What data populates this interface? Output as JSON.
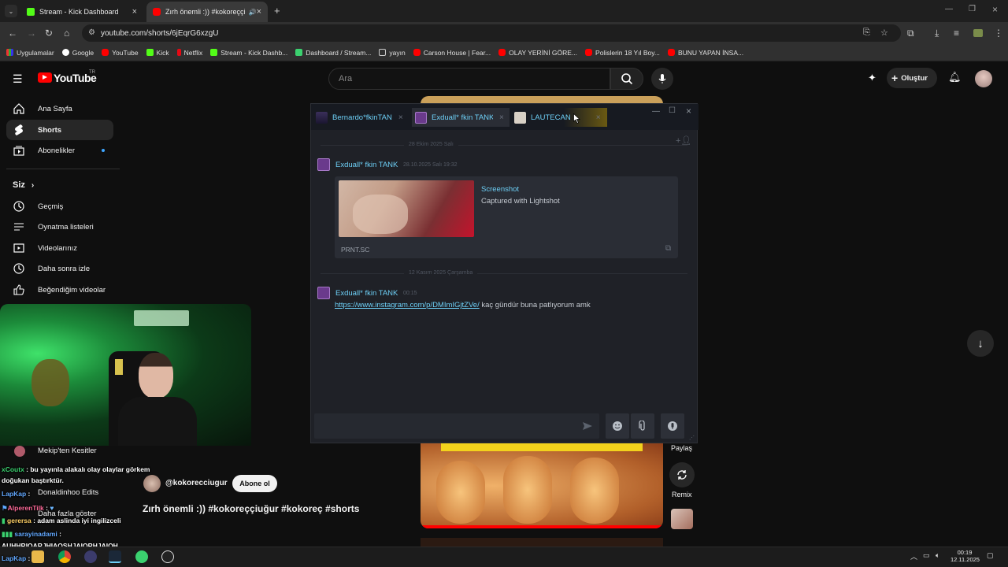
{
  "browser": {
    "tabs": [
      {
        "title": "Stream - Kick Dashboard",
        "active": false
      },
      {
        "title": "Zırh önemli :)) #kokoreççiu",
        "active": true
      }
    ],
    "new_tab": "+",
    "url": "youtube.com/shorts/6jEqrG6xzgU",
    "bookmarks": [
      "Uygulamalar",
      "Google",
      "YouTube",
      "Kick",
      "Netflix",
      "Stream - Kick Dashb...",
      "Dashboard / Stream...",
      "yayın",
      "Carson House | Fear...",
      "OLAY YERİNİ GÖRE...",
      "Polislerin 18 Yıl Boy...",
      "BUNU YAPAN İNSA..."
    ]
  },
  "youtube": {
    "logo": "YouTube",
    "logo_sup": "TR",
    "search_placeholder": "Ara",
    "create_label": "Oluştur",
    "sidebar": {
      "main": [
        "Ana Sayfa",
        "Shorts",
        "Abonelikler"
      ],
      "you_header": "Siz",
      "you_items": [
        "Geçmiş",
        "Oynatma listeleri",
        "Videolarınız",
        "Daha sonra izle",
        "Beğendiğim videolar"
      ],
      "subs": [
        "Mekip'ten Kesitler",
        "Donaldinhoo Edits",
        "Daha fazla göster"
      ]
    },
    "short": {
      "channel": "@kokorecciugur",
      "subscribe": "Abone ol",
      "title": "Zırh önemli :))  #kokoreççiuğur #kokoreç #shorts",
      "actions": {
        "share": "Paylaş",
        "remix": "Remix"
      }
    }
  },
  "steam_chat": {
    "tabs": [
      {
        "name": "Bernardo*fkinTAN"
      },
      {
        "name": "Exduall* fkin TANK"
      },
      {
        "name": "LAUTECAN"
      }
    ],
    "date1": "28 Ekim 2025 Salı",
    "msg1": {
      "author": "Exduall* fkin TANK",
      "time": "28.10.2025 Salı 19:32"
    },
    "embed": {
      "title": "Screenshot",
      "desc": "Captured with Lightshot",
      "site": "PRNT.SC"
    },
    "date2": "12 Kasım 2025 Çarşamba",
    "msg2": {
      "author": "Exduall* fkin TANK",
      "time": "00:15",
      "link": "https://www.instagram.com/p/DMImIGjtZVe/",
      "text": " kaç gündür buna patlıyorum amk"
    }
  },
  "overlay_chat": [
    {
      "user": "xCoutx",
      "text": " : bu yayınla alakalı olay olaylar görkem"
    },
    {
      "user": "",
      "text": "doğukan baştırktür."
    },
    {
      "user": "LapKap",
      "text": " :"
    },
    {
      "user": "AlperenTilk",
      "text": " :"
    },
    {
      "user": "gerersa",
      "text": " : adam aslinda iyi ingilizceli"
    },
    {
      "user": "sarayinadami",
      "text": " :"
    },
    {
      "user": "",
      "text": "AUHHRIOARJHIAOŞHJAIORHJAIOH"
    },
    {
      "user": "LapKap",
      "text": " :"
    }
  ],
  "taskbar": {
    "time": "00:19",
    "date": "12.11.2025"
  },
  "colors": {
    "accent_blue": "#6dcff6",
    "yt_red": "#ff0000",
    "kick_green": "#53fc18"
  }
}
